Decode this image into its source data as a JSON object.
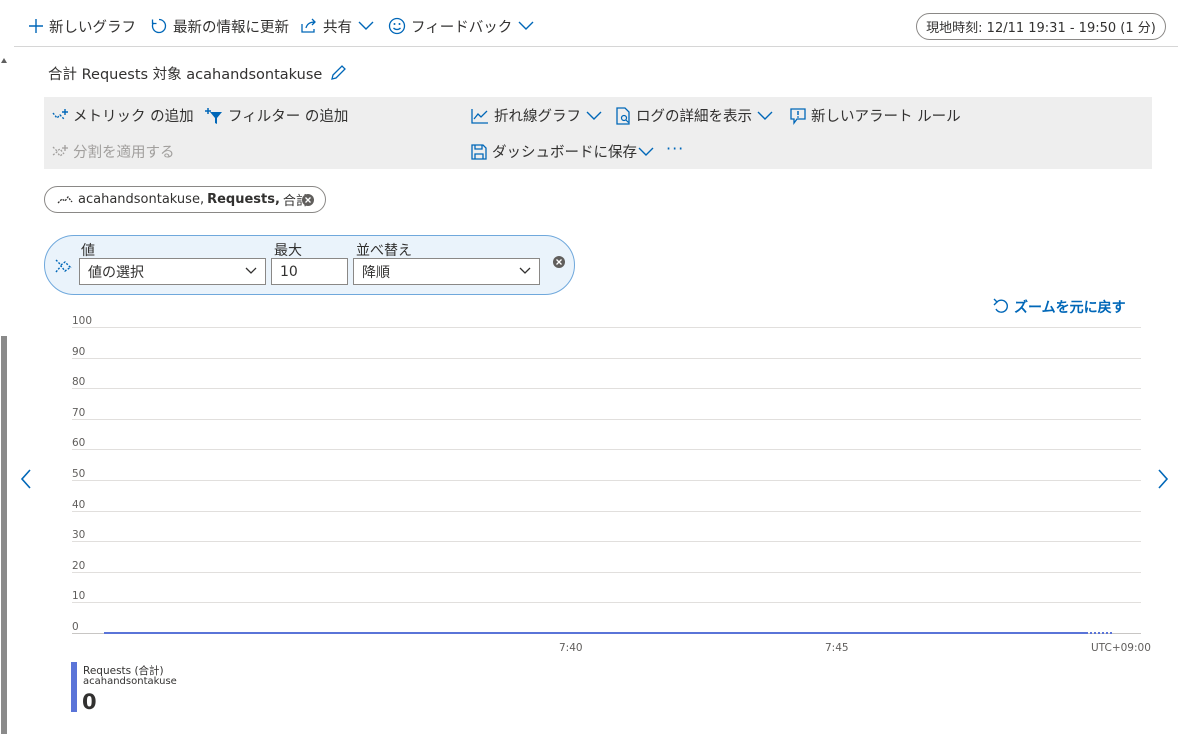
{
  "toolbar": {
    "new_chart": "新しいグラフ",
    "refresh": "最新の情報に更新",
    "share": "共有",
    "feedback": "フィードバック",
    "time_range": "現地時刻: 12/11 19:31 - 19:50 (1 分)"
  },
  "chart_title": "合計 Requests 対象 acahandsontakuse",
  "commands": {
    "add_metric": "メトリック の追加",
    "add_filter": "フィルター の追加",
    "apply_split": "分割を適用する",
    "line_chart": "折れ線グラフ",
    "view_logs": "ログの詳細を表示",
    "new_alert": "新しいアラート ルール",
    "save_dashboard": "ダッシュボードに保存",
    "more": "···"
  },
  "metric_pill": {
    "resource": "acahandsontakuse,",
    "metric": "Requests,",
    "aggregation": "合計"
  },
  "split": {
    "values_label": "値",
    "values_placeholder": "値の選択",
    "max_label": "最大",
    "max_value": "10",
    "sort_label": "並べ替え",
    "sort_value": "降順"
  },
  "reset_zoom": "ズームを元に戻す",
  "chart_data": {
    "type": "line",
    "y_ticks": [
      "100",
      "90",
      "80",
      "70",
      "60",
      "50",
      "40",
      "30",
      "20",
      "10",
      "0"
    ],
    "ylim": [
      0,
      100
    ],
    "x_ticks": [
      "7:40",
      "7:45"
    ],
    "timezone": "UTC+09:00",
    "series": [
      {
        "name": "Requests (合計)",
        "resource": "acahandsontakuse",
        "values": [
          0
        ],
        "color": "#5a74d8"
      }
    ]
  },
  "legend": {
    "name": "Requests (合計)",
    "resource": "acahandsontakuse",
    "value": "0"
  },
  "colors": {
    "accent": "#0067b8",
    "series": "#5a74d8",
    "command_bar": "#eeeeee",
    "split_panel": "#eaf3fb"
  }
}
